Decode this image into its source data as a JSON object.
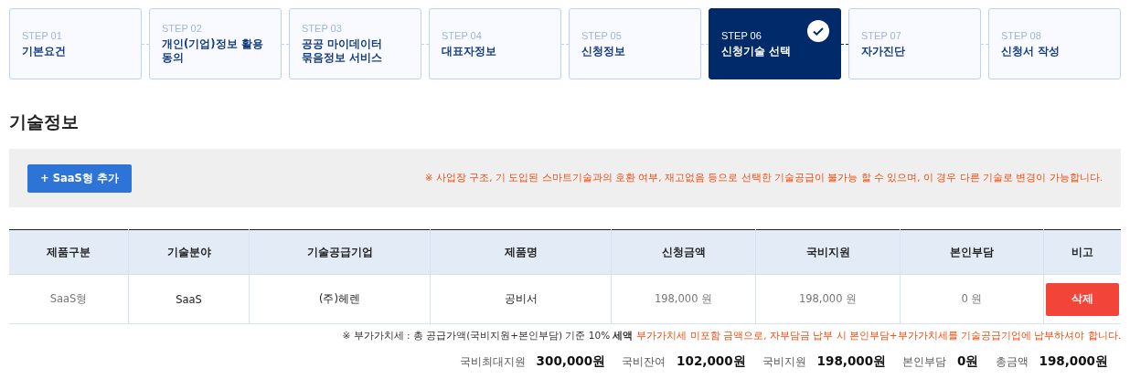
{
  "steps": [
    {
      "number": "STEP 01",
      "label": "기본요건",
      "selected": false
    },
    {
      "number": "STEP 02",
      "label": "개인(기업)정보 활용동의",
      "selected": false
    },
    {
      "number": "STEP 03",
      "label": "공공 마이데이터\n묶음정보 서비스",
      "selected": false
    },
    {
      "number": "STEP 04",
      "label": "대표자정보",
      "selected": false
    },
    {
      "number": "STEP 05",
      "label": "신청정보",
      "selected": false
    },
    {
      "number": "STEP 06",
      "label": "신청기술 선택",
      "selected": true
    },
    {
      "number": "STEP 07",
      "label": "자가진단",
      "selected": false
    },
    {
      "number": "STEP 08",
      "label": "신청서 작성",
      "selected": false
    }
  ],
  "section_title": "기술정보",
  "toolbar": {
    "add_button": "+ SaaS형 추가",
    "notice": "※ 사업장 구조, 기 도입된 스마트기술과의 호환 여부, 재고없음 등으로 선택한 기술공급이 불가능 할 수 있으며, 이 경우 다른 기술로 변경이 가능합니다."
  },
  "table": {
    "columns": [
      "제품구분",
      "기술분야",
      "기술공급기업",
      "제품명",
      "신청금액",
      "국비지원",
      "본인부담",
      "비고"
    ],
    "rows": [
      {
        "cells": [
          "SaaS형",
          "SaaS",
          "(주)헤렌",
          "공비서",
          "198,000 원",
          "198,000 원",
          "0 원"
        ],
        "delete_button": "삭제"
      }
    ]
  },
  "vat_note": {
    "text": "※ 부가가치세 : 총 공급가액(국비지원+본인부담) 기준 10% **세액**",
    "highlight": "부가가치세 미포함 금액으로, 자부담금 납부 시 본인부담+부가가치세를 기술공급기업에 납부하셔야 합니다."
  },
  "summary": [
    {
      "label": "국비최대지원",
      "value": "300,000원"
    },
    {
      "label": "국비잔여",
      "value": "102,000원"
    },
    {
      "label": "국비지원",
      "value": "198,000원"
    },
    {
      "label": "본인부담",
      "value": "0원"
    },
    {
      "label": "총금액",
      "value": "198,000원"
    }
  ]
}
